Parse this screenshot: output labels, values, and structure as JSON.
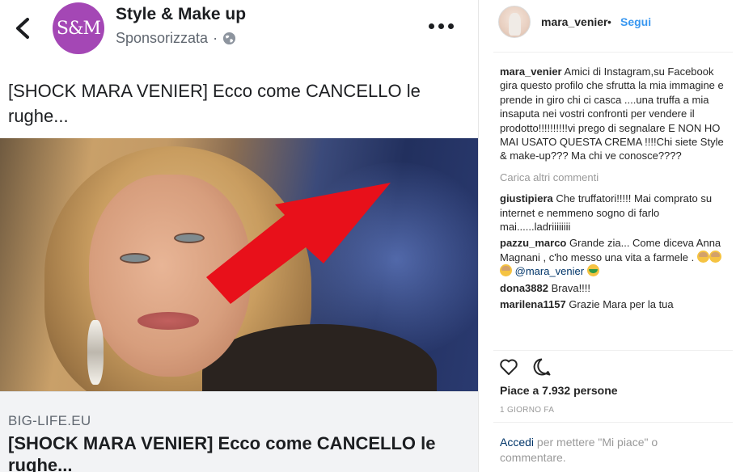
{
  "facebook_post": {
    "avatar_text": "S&M",
    "page_name": "Style & Make up",
    "sponsored_label": "Sponsorizzata",
    "sponsored_separator": "·",
    "caption": "[SHOCK MARA VENIER] Ecco come CANCELLO le rughe...",
    "link_domain": "BIG-LIFE.EU",
    "link_headline": "[SHOCK MARA VENIER] Ecco come CANCELLO le rughe..."
  },
  "instagram": {
    "username": "mara_venier",
    "header_separator": "•",
    "follow_label": "Segui",
    "caption": {
      "user": "mara_venier",
      "text": "Amici di Instagram,su Facebook gira questo profilo che sfrutta la mia immagine e prende in giro chi ci casca ....una truffa a mia insaputa nei vostri confronti per vendere il prodotto!!!!!!!!!!vi prego di segnalare E NON HO MAI USATO QUESTA CREMA !!!!Chi siete Style & make-up??? Ma chi ve conosce????"
    },
    "load_more_label": "Carica altri commenti",
    "comments": [
      {
        "user": "giustipiera",
        "text": "Che truffatori!!!!! Mai comprato su internet e nemmeno sogno di farlo mai......ladriiiiiiii"
      },
      {
        "user": "pazzu_marco",
        "text": "Grande zia... Come diceva Anna Magnani , c'ho messo una vita a farmele .",
        "mention": "@mara_venier"
      },
      {
        "user": "dona3882",
        "text": "Brava!!!!"
      },
      {
        "user": "marilena1157",
        "text": "Grazie Mara per la tua correttezza"
      }
    ],
    "likes_label": "Piace a 7.932 persone",
    "time_label": "1 GIORNO FA",
    "login_link": "Accedi",
    "login_text": " per mettere \"Mi piace\" o commentare.",
    "icons": {
      "like": "heart-icon",
      "comment": "comment-bubble-icon"
    },
    "colors": {
      "link": "#3897f0",
      "mention": "#003569",
      "muted": "#999999"
    }
  }
}
